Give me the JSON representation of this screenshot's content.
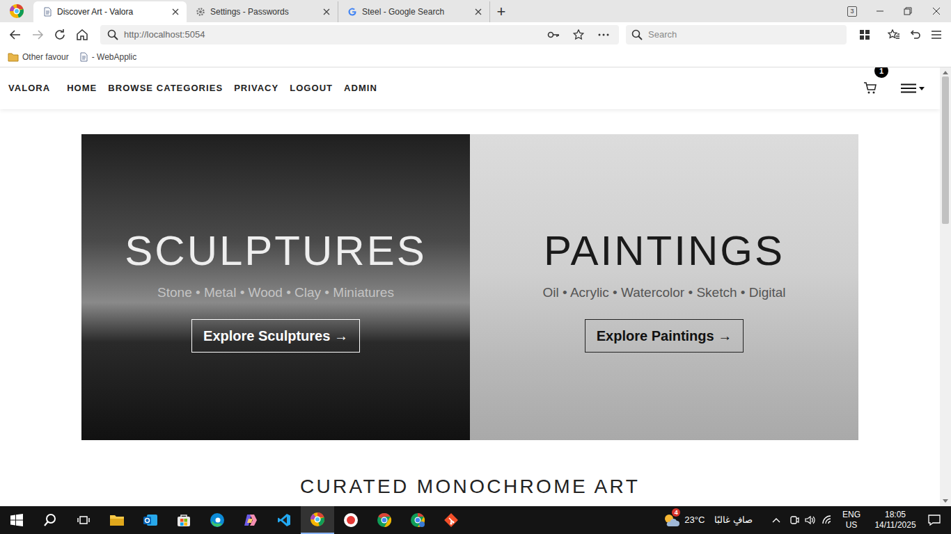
{
  "browser": {
    "tabs": [
      {
        "label": "Discover Art - Valora",
        "selected": true
      },
      {
        "label": "Settings - Passwords",
        "selected": false
      },
      {
        "label": "Steel - Google Search",
        "selected": false
      }
    ],
    "new_tab": "+",
    "tab_count": "3"
  },
  "address": {
    "url": "http://localhost:5054"
  },
  "search": {
    "placeholder": "Search"
  },
  "bookmarks": [
    "Other favour",
    "- WebApplic"
  ],
  "nav": {
    "brand": "VALORA",
    "items": [
      "HOME",
      "BROWSE CATEGORIES",
      "PRIVACY",
      "LOGOUT",
      "ADMIN"
    ],
    "cart_count": "1"
  },
  "hero": [
    {
      "title": "SCULPTURES",
      "subtitle": "Stone • Metal • Wood • Clay • Miniatures",
      "button": "Explore Sculptures →",
      "kind": "dark"
    },
    {
      "title": "PAINTINGS",
      "subtitle": "Oil • Acrylic • Watercolor • Sketch • Digital",
      "button": "Explore Paintings →",
      "kind": "light"
    }
  ],
  "section_title": "CURATED MONOCHROME ART",
  "taskbar": {
    "weather_badge": "4",
    "temperature": "23°C",
    "weather": "صافٍ غالبًا",
    "lang": "ENG",
    "region": "US",
    "time": "18:05",
    "date": "14/11/2025"
  }
}
